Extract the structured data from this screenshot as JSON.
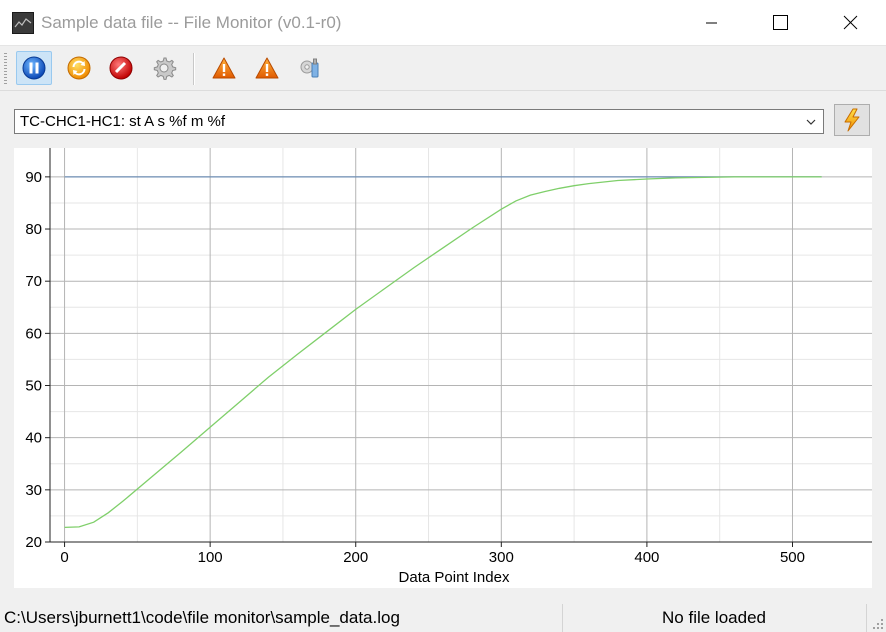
{
  "window": {
    "title": "Sample data file -- File Monitor (v0.1-r0)"
  },
  "toolbar": {
    "buttons": [
      {
        "icon": "pause-icon",
        "active": true
      },
      {
        "icon": "refresh-icon",
        "active": false
      },
      {
        "icon": "stop-icon",
        "active": false
      },
      {
        "icon": "gear-icon",
        "active": false
      },
      {
        "icon": "warning-icon",
        "active": false
      },
      {
        "icon": "warning-icon",
        "active": false
      },
      {
        "icon": "settings-wrench-icon",
        "active": false
      }
    ]
  },
  "channel_select": {
    "value": "TC-CHC1-HC1: st A  s %f  m %f"
  },
  "chart_data": {
    "type": "line",
    "xlabel": "Data Point Index",
    "ylabel": "",
    "xlim": [
      -10,
      545
    ],
    "ylim": [
      20,
      94
    ],
    "xticks": [
      0,
      100,
      200,
      300,
      400,
      500
    ],
    "yticks": [
      20,
      30,
      40,
      50,
      60,
      70,
      80,
      90
    ],
    "grid": true,
    "series": [
      {
        "color": "#6f8fb5",
        "x": [
          0,
          520
        ],
        "y": [
          90,
          90
        ]
      },
      {
        "color": "#7fcf6a",
        "x": [
          0,
          10,
          20,
          30,
          40,
          60,
          80,
          100,
          120,
          140,
          160,
          180,
          200,
          220,
          240,
          260,
          280,
          300,
          310,
          320,
          330,
          340,
          350,
          360,
          380,
          400,
          420,
          440,
          460,
          480,
          500,
          520
        ],
        "y": [
          22.8,
          22.9,
          23.8,
          25.6,
          27.8,
          32.5,
          37.2,
          42.0,
          46.8,
          51.6,
          56.0,
          60.3,
          64.6,
          68.6,
          72.6,
          76.4,
          80.2,
          83.8,
          85.4,
          86.5,
          87.2,
          87.8,
          88.3,
          88.7,
          89.3,
          89.6,
          89.8,
          89.9,
          90.0,
          90.0,
          90.0,
          90.0
        ]
      }
    ]
  },
  "status": {
    "path": "C:\\Users\\jburnett1\\code\\file monitor\\sample_data.log",
    "file_state": "No file loaded"
  }
}
